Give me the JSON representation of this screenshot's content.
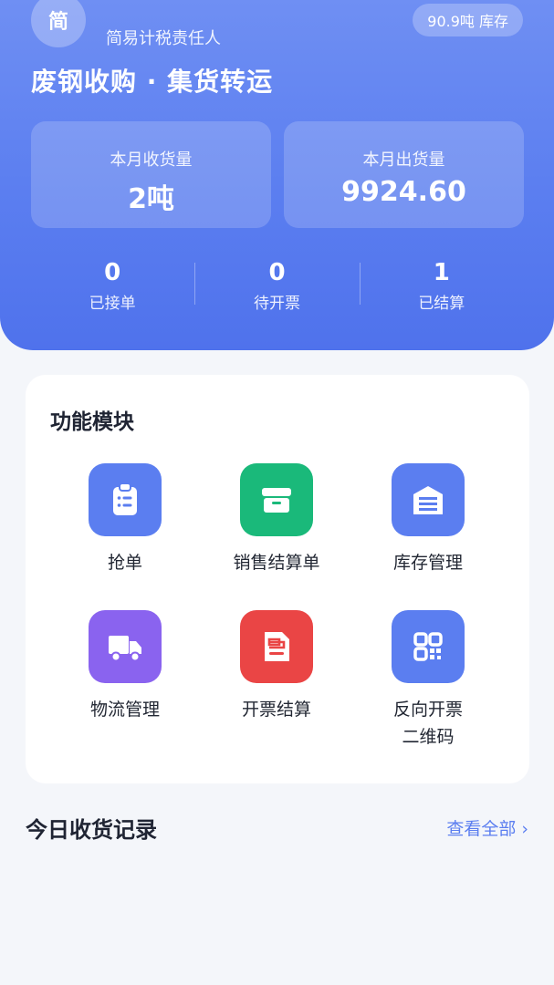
{
  "header": {
    "avatar_text": "简",
    "role_text": "简易计税责任人",
    "stock_badge": "90.9吨 库存",
    "business_title": "废钢收购 · 集货转运"
  },
  "stats": {
    "monthly_received": {
      "label": "本月收货量",
      "value": "2吨"
    },
    "monthly_shipped": {
      "label": "本月出货量",
      "value": "9924.60"
    }
  },
  "counts": [
    {
      "value": "0",
      "label": "已接单"
    },
    {
      "value": "0",
      "label": "待开票"
    },
    {
      "value": "1",
      "label": "已结算"
    }
  ],
  "modules": {
    "title": "功能模块",
    "items": [
      {
        "label": "抢单",
        "icon": "clipboard-list-icon",
        "color": "#5b7ef0"
      },
      {
        "label": "销售结算单",
        "icon": "box-icon",
        "color": "#1ab97a"
      },
      {
        "label": "库存管理",
        "icon": "warehouse-icon",
        "color": "#5b7ef0"
      },
      {
        "label": "物流管理",
        "icon": "truck-icon",
        "color": "#8a63ef"
      },
      {
        "label": "开票结算",
        "icon": "invoice-icon",
        "color": "#ea4545"
      },
      {
        "label": "反向开票\n二维码",
        "icon": "qr-code-icon",
        "color": "#5b7ef0"
      }
    ]
  },
  "today": {
    "title": "今日收货记录",
    "view_all": "查看全部 ›"
  }
}
